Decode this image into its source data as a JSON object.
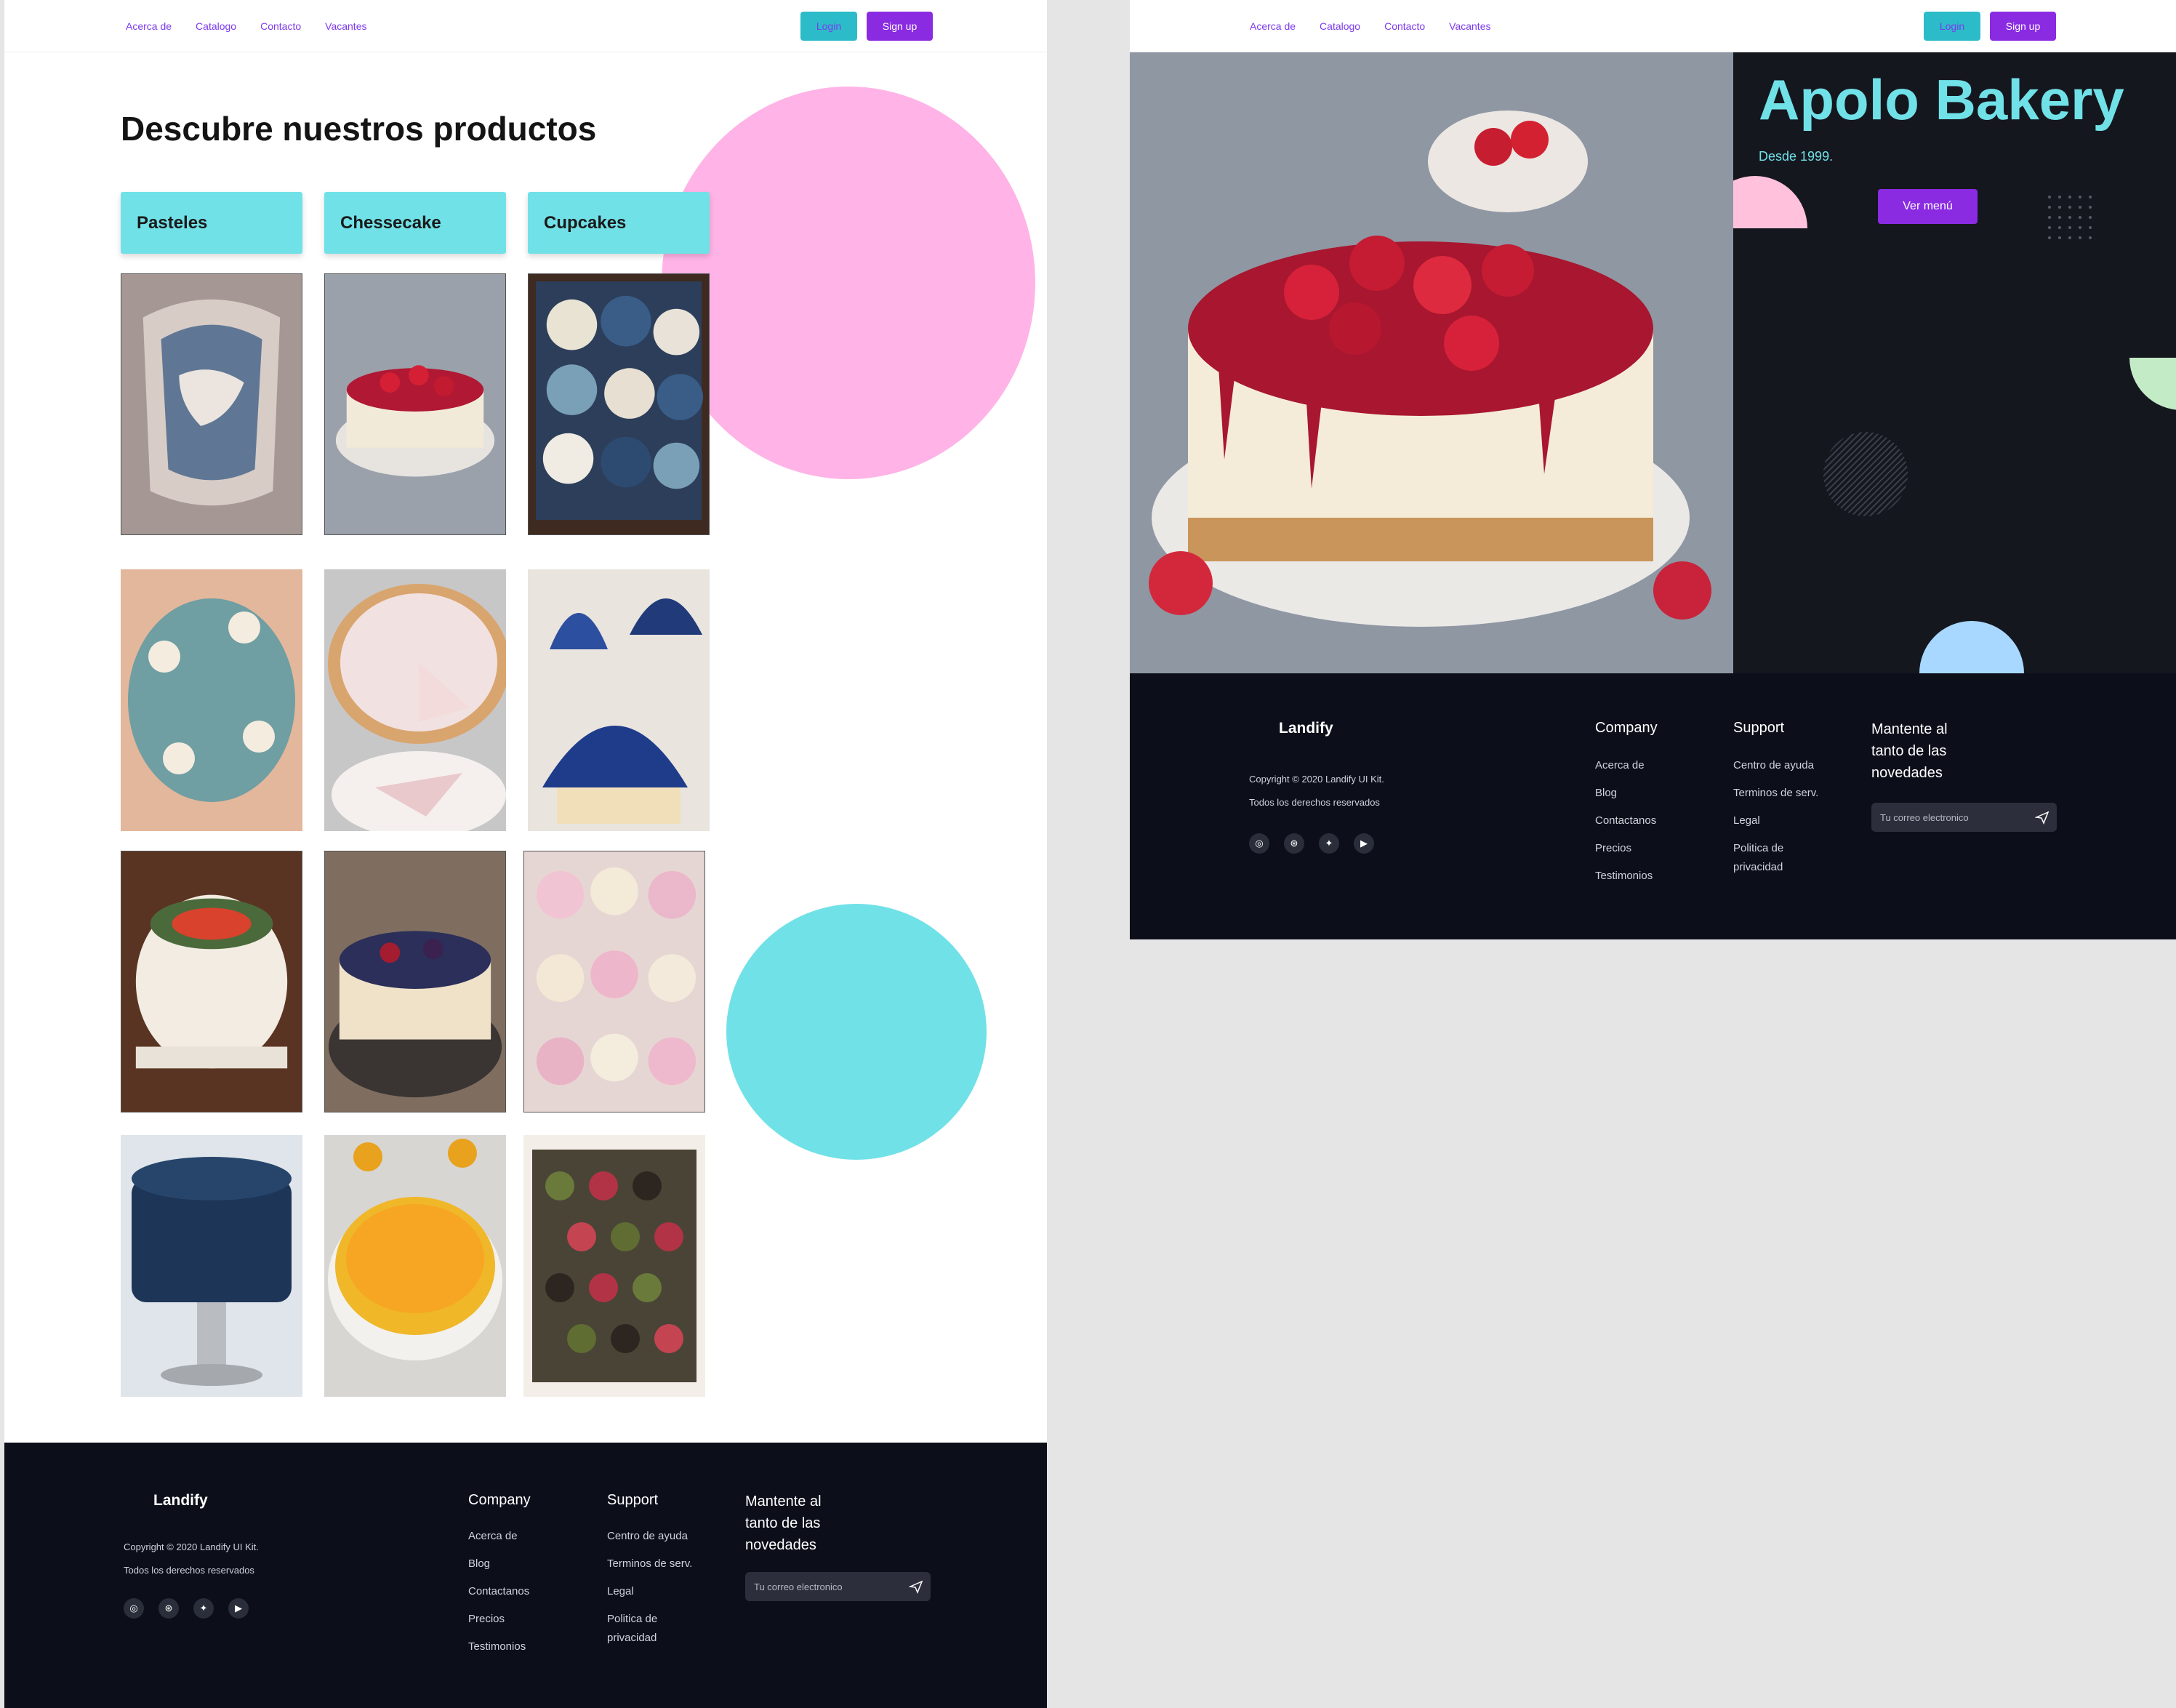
{
  "nav": {
    "links": [
      "Acerca de",
      "Catalogo",
      "Contacto",
      "Vacantes"
    ],
    "login_label": "Login",
    "signup_label": "Sign up"
  },
  "catalog": {
    "title": "Descubre nuestros productos",
    "categories": [
      "Pasteles",
      "Chessecake",
      "Cupcakes"
    ]
  },
  "hero": {
    "title": "Apolo Bakery",
    "subtitle": "Desde 1999.",
    "cta_label": "Ver menú"
  },
  "footer": {
    "logo": "Landify",
    "copyright": "Copyright © 2020 Landify UI Kit.",
    "rights": "Todos los derechos reservados",
    "social_icons": [
      "instagram-icon",
      "dribbble-icon",
      "twitter-icon",
      "youtube-icon"
    ],
    "company_title": "Company",
    "company_links": [
      "Acerca de",
      "Blog",
      "Contactanos",
      "Precios",
      "Testimonios"
    ],
    "support_title": "Support",
    "support_links": [
      "Centro de ayuda",
      "Terminos de serv.",
      "Legal",
      "Politica de privacidad"
    ],
    "newsletter_title": "Mantente al tanto de las novedades",
    "email_placeholder": "Tu correo electronico"
  },
  "colors": {
    "accent_cyan": "#71e1e8",
    "accent_purple": "#8a2be2",
    "accent_pink": "#ffb3e6",
    "footer_bg": "#0c0f1a"
  }
}
